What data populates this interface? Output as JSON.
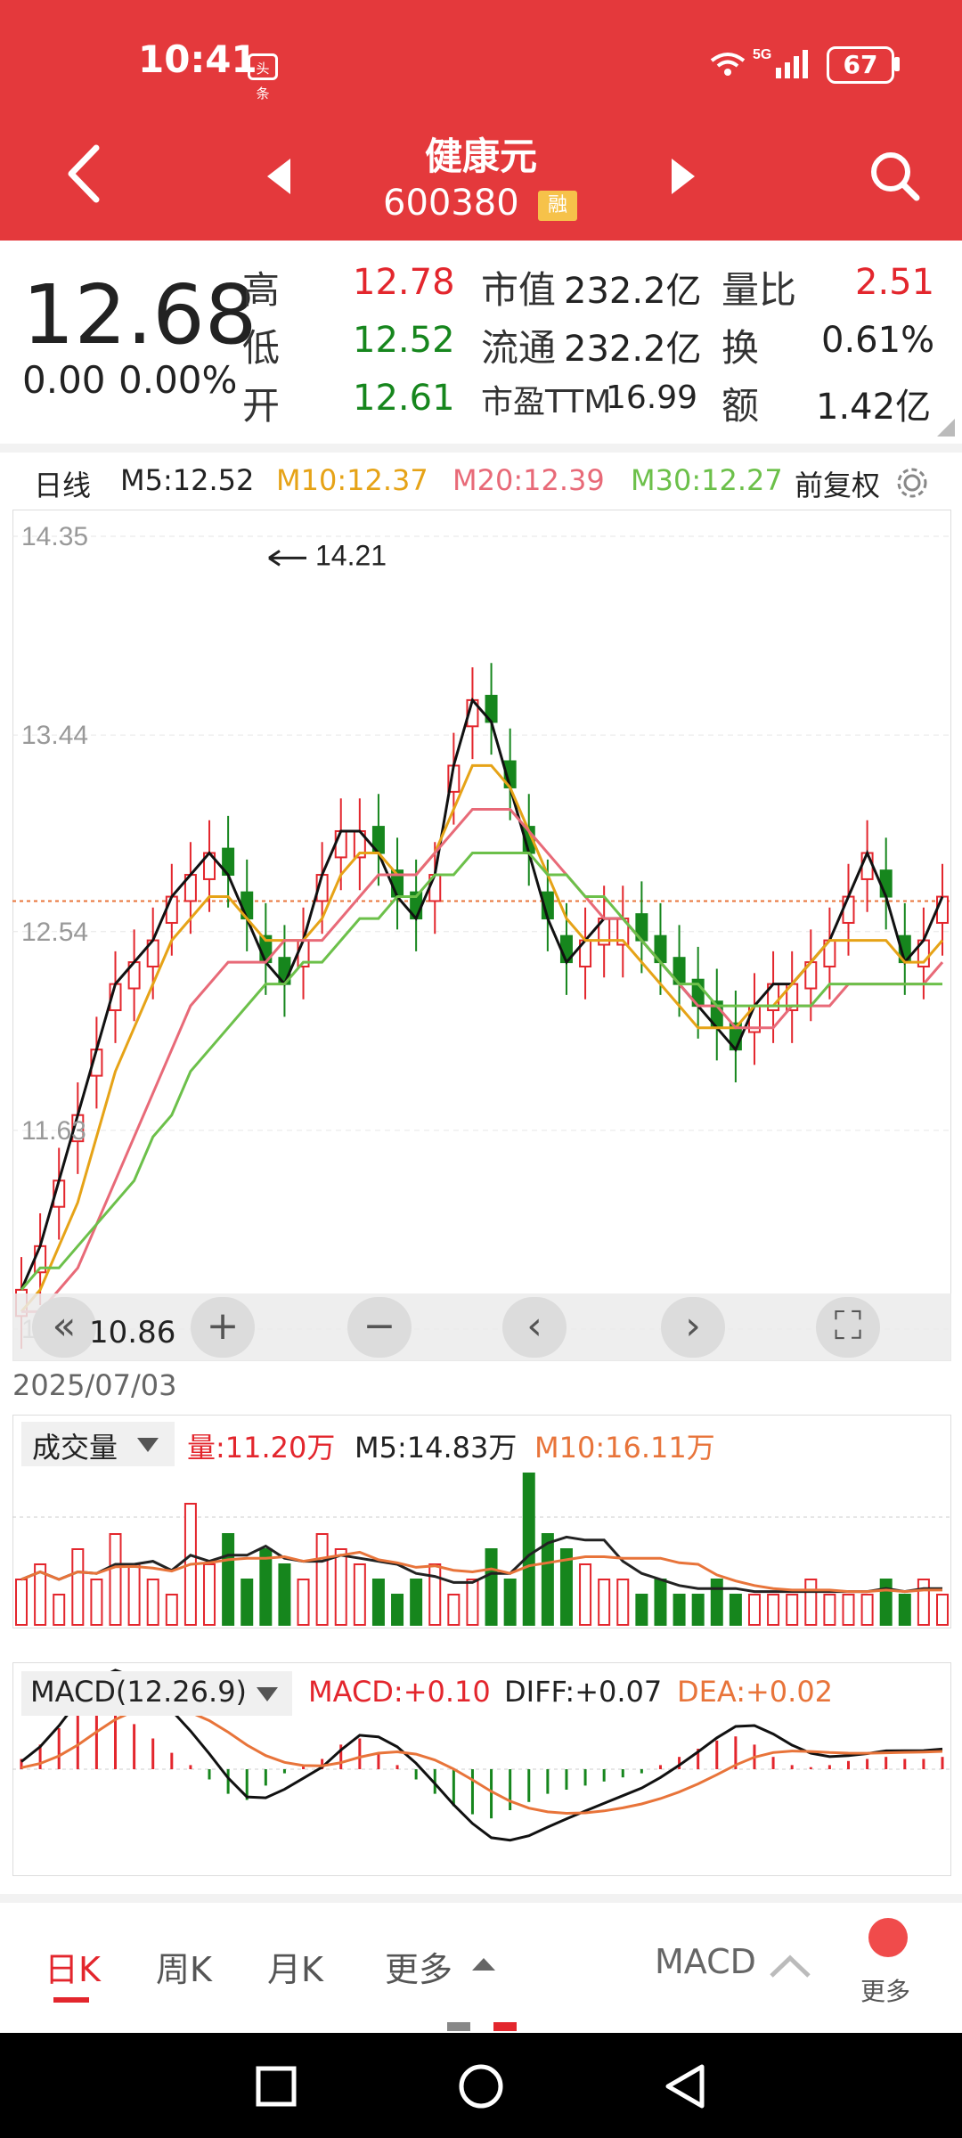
{
  "status": {
    "time": "10:41",
    "badge": "头条",
    "network": "5G",
    "battery": "67"
  },
  "header": {
    "name": "健康元",
    "code": "600380",
    "margin_badge": "融"
  },
  "quote": {
    "price": "12.68",
    "change": "0.00",
    "change_pct": "0.00%",
    "rows": [
      {
        "l1": "高",
        "v1": "12.78",
        "l2": "市值",
        "v2": "232.2亿",
        "l3": "量比",
        "v3": "2.51"
      },
      {
        "l1": "低",
        "v1": "12.52",
        "l2": "流通",
        "v2": "232.2亿",
        "l3": "换",
        "v3": "0.61%"
      },
      {
        "l1": "开",
        "v1": "12.61",
        "l2": "市盈TTM",
        "v2": "16.99",
        "l3": "额",
        "v3": "1.42亿"
      }
    ]
  },
  "ma_bar": {
    "period": "日线",
    "m5": "M5:12.52",
    "m10": "M10:12.37",
    "m20": "M20:12.39",
    "m30": "M30:12.27",
    "adjust": "前复权"
  },
  "colors": {
    "up": "#e3262d",
    "down": "#16861d",
    "m5": "#111111",
    "m10": "#e6a317",
    "m20": "#e86a78",
    "m30": "#6cc04a",
    "brand": "#e4393c"
  },
  "chart_data": [
    {
      "type": "candlestick",
      "title": "日线",
      "y_ticks": [
        "14.35",
        "13.44",
        "12.54",
        "11.63",
        "10.72"
      ],
      "ylim": [
        10.72,
        14.35
      ],
      "annotations": {
        "high": "14.21",
        "low": "10.86",
        "current_line": 12.68
      },
      "date_label": "2025/07/03",
      "series": [
        {
          "name": "M5",
          "values": [
            10.9,
            11.1,
            11.4,
            11.7,
            12.0,
            12.3,
            12.4,
            12.5,
            12.7,
            12.8,
            12.9,
            12.8,
            12.6,
            12.4,
            12.3,
            12.5,
            12.8,
            13.0,
            13.0,
            12.9,
            12.7,
            12.6,
            12.8,
            13.3,
            13.6,
            13.5,
            13.2,
            12.9,
            12.6,
            12.4,
            12.5,
            12.6,
            12.6,
            12.5,
            12.4,
            12.3,
            12.2,
            12.1,
            12.0,
            12.2,
            12.3,
            12.3,
            12.4,
            12.5,
            12.7,
            12.9,
            12.7,
            12.4,
            12.5,
            12.7
          ]
        },
        {
          "name": "M10",
          "values": [
            10.8,
            10.9,
            11.1,
            11.3,
            11.6,
            11.9,
            12.1,
            12.3,
            12.5,
            12.6,
            12.7,
            12.7,
            12.6,
            12.5,
            12.5,
            12.5,
            12.6,
            12.8,
            12.9,
            12.9,
            12.8,
            12.8,
            12.9,
            13.1,
            13.3,
            13.3,
            13.2,
            13.0,
            12.8,
            12.6,
            12.5,
            12.5,
            12.5,
            12.4,
            12.3,
            12.2,
            12.1,
            12.1,
            12.1,
            12.2,
            12.2,
            12.3,
            12.4,
            12.5,
            12.5,
            12.5,
            12.5,
            12.4,
            12.4,
            12.5
          ]
        },
        {
          "name": "M20",
          "values": [
            10.8,
            10.8,
            10.9,
            11.0,
            11.2,
            11.4,
            11.6,
            11.8,
            12.0,
            12.2,
            12.3,
            12.4,
            12.4,
            12.4,
            12.5,
            12.5,
            12.5,
            12.6,
            12.7,
            12.8,
            12.8,
            12.8,
            12.9,
            13.0,
            13.1,
            13.1,
            13.1,
            13.0,
            12.9,
            12.8,
            12.7,
            12.6,
            12.6,
            12.5,
            12.4,
            12.3,
            12.2,
            12.2,
            12.1,
            12.1,
            12.1,
            12.2,
            12.2,
            12.2,
            12.3,
            12.3,
            12.3,
            12.3,
            12.3,
            12.4
          ]
        },
        {
          "name": "M30",
          "values": [
            10.9,
            11.0,
            11.0,
            11.1,
            11.2,
            11.3,
            11.4,
            11.6,
            11.7,
            11.9,
            12.0,
            12.1,
            12.2,
            12.3,
            12.3,
            12.4,
            12.4,
            12.5,
            12.6,
            12.6,
            12.7,
            12.7,
            12.8,
            12.8,
            12.9,
            12.9,
            12.9,
            12.9,
            12.8,
            12.8,
            12.7,
            12.7,
            12.6,
            12.5,
            12.4,
            12.3,
            12.3,
            12.2,
            12.2,
            12.2,
            12.2,
            12.2,
            12.2,
            12.3,
            12.3,
            12.3,
            12.3,
            12.3,
            12.3,
            12.3
          ]
        }
      ]
    },
    {
      "type": "bar",
      "title": "成交量",
      "legend": {
        "vol": "量:11.20万",
        "m5": "M5:14.83万",
        "m10": "M10:16.11万"
      },
      "values": [
        3,
        4,
        2,
        5,
        3,
        6,
        4,
        3,
        2,
        8,
        4,
        6,
        3,
        5,
        4,
        3,
        6,
        5,
        4,
        3,
        2,
        3,
        4,
        2,
        3,
        5,
        3,
        10,
        6,
        5,
        4,
        3,
        3,
        2,
        3,
        2,
        2,
        3,
        2,
        2,
        2,
        2,
        3,
        2,
        2,
        2,
        3,
        2,
        3,
        2
      ]
    },
    {
      "type": "bar",
      "title": "MACD(12.26.9)",
      "legend": {
        "macd": "MACD:+0.10",
        "diff": "DIFF:+0.07",
        "dea": "DEA:+0.02"
      },
      "values": [
        0.05,
        0.12,
        0.2,
        0.28,
        0.33,
        0.3,
        0.22,
        0.15,
        0.08,
        0.02,
        -0.05,
        -0.12,
        -0.15,
        -0.08,
        -0.02,
        0.02,
        0.05,
        0.12,
        0.15,
        0.08,
        0.02,
        -0.05,
        -0.12,
        -0.18,
        -0.22,
        -0.24,
        -0.2,
        -0.16,
        -0.12,
        -0.1,
        -0.08,
        -0.06,
        -0.04,
        -0.02,
        0.02,
        0.06,
        0.1,
        0.14,
        0.16,
        0.12,
        0.06,
        0.02,
        0.01,
        0.02,
        0.04,
        0.05,
        0.06,
        0.05,
        0.05,
        0.06
      ]
    }
  ],
  "chart_controls": [
    "«",
    "+",
    "−",
    "‹",
    "›",
    "⛶"
  ],
  "tabs": {
    "day": "日K",
    "week": "周K",
    "month": "月K",
    "more": "更多",
    "indicator": "MACD",
    "more_btn": "更多"
  }
}
